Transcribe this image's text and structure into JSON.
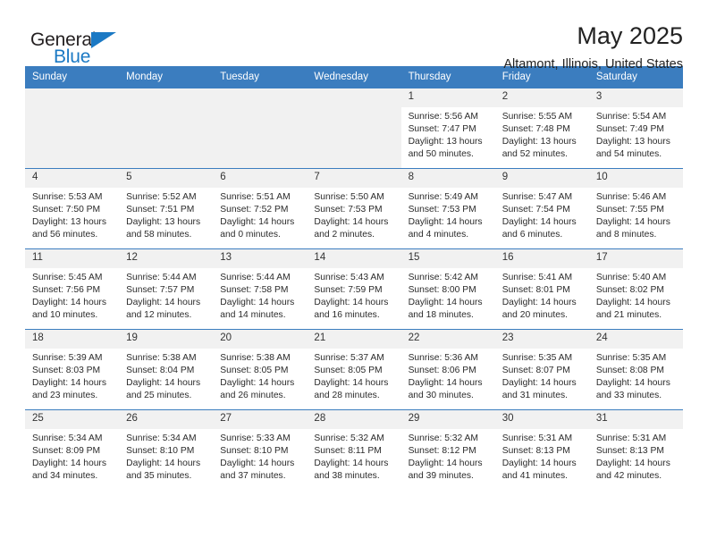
{
  "brand": {
    "name_part1": "General",
    "name_part2": "Blue",
    "accent_color": "#1b79c4"
  },
  "header": {
    "month_title": "May 2025",
    "location": "Altamont, Illinois, United States"
  },
  "calendar": {
    "header_color": "#3b7dbf",
    "daynum_band_color": "#f1f1f1",
    "day_names": [
      "Sunday",
      "Monday",
      "Tuesday",
      "Wednesday",
      "Thursday",
      "Friday",
      "Saturday"
    ],
    "weeks": [
      [
        {
          "day": "",
          "empty": true
        },
        {
          "day": "",
          "empty": true
        },
        {
          "day": "",
          "empty": true
        },
        {
          "day": "",
          "empty": true
        },
        {
          "day": "1",
          "sunrise": "Sunrise: 5:56 AM",
          "sunset": "Sunset: 7:47 PM",
          "daylight": "Daylight: 13 hours and 50 minutes."
        },
        {
          "day": "2",
          "sunrise": "Sunrise: 5:55 AM",
          "sunset": "Sunset: 7:48 PM",
          "daylight": "Daylight: 13 hours and 52 minutes."
        },
        {
          "day": "3",
          "sunrise": "Sunrise: 5:54 AM",
          "sunset": "Sunset: 7:49 PM",
          "daylight": "Daylight: 13 hours and 54 minutes."
        }
      ],
      [
        {
          "day": "4",
          "sunrise": "Sunrise: 5:53 AM",
          "sunset": "Sunset: 7:50 PM",
          "daylight": "Daylight: 13 hours and 56 minutes."
        },
        {
          "day": "5",
          "sunrise": "Sunrise: 5:52 AM",
          "sunset": "Sunset: 7:51 PM",
          "daylight": "Daylight: 13 hours and 58 minutes."
        },
        {
          "day": "6",
          "sunrise": "Sunrise: 5:51 AM",
          "sunset": "Sunset: 7:52 PM",
          "daylight": "Daylight: 14 hours and 0 minutes."
        },
        {
          "day": "7",
          "sunrise": "Sunrise: 5:50 AM",
          "sunset": "Sunset: 7:53 PM",
          "daylight": "Daylight: 14 hours and 2 minutes."
        },
        {
          "day": "8",
          "sunrise": "Sunrise: 5:49 AM",
          "sunset": "Sunset: 7:53 PM",
          "daylight": "Daylight: 14 hours and 4 minutes."
        },
        {
          "day": "9",
          "sunrise": "Sunrise: 5:47 AM",
          "sunset": "Sunset: 7:54 PM",
          "daylight": "Daylight: 14 hours and 6 minutes."
        },
        {
          "day": "10",
          "sunrise": "Sunrise: 5:46 AM",
          "sunset": "Sunset: 7:55 PM",
          "daylight": "Daylight: 14 hours and 8 minutes."
        }
      ],
      [
        {
          "day": "11",
          "sunrise": "Sunrise: 5:45 AM",
          "sunset": "Sunset: 7:56 PM",
          "daylight": "Daylight: 14 hours and 10 minutes."
        },
        {
          "day": "12",
          "sunrise": "Sunrise: 5:44 AM",
          "sunset": "Sunset: 7:57 PM",
          "daylight": "Daylight: 14 hours and 12 minutes."
        },
        {
          "day": "13",
          "sunrise": "Sunrise: 5:44 AM",
          "sunset": "Sunset: 7:58 PM",
          "daylight": "Daylight: 14 hours and 14 minutes."
        },
        {
          "day": "14",
          "sunrise": "Sunrise: 5:43 AM",
          "sunset": "Sunset: 7:59 PM",
          "daylight": "Daylight: 14 hours and 16 minutes."
        },
        {
          "day": "15",
          "sunrise": "Sunrise: 5:42 AM",
          "sunset": "Sunset: 8:00 PM",
          "daylight": "Daylight: 14 hours and 18 minutes."
        },
        {
          "day": "16",
          "sunrise": "Sunrise: 5:41 AM",
          "sunset": "Sunset: 8:01 PM",
          "daylight": "Daylight: 14 hours and 20 minutes."
        },
        {
          "day": "17",
          "sunrise": "Sunrise: 5:40 AM",
          "sunset": "Sunset: 8:02 PM",
          "daylight": "Daylight: 14 hours and 21 minutes."
        }
      ],
      [
        {
          "day": "18",
          "sunrise": "Sunrise: 5:39 AM",
          "sunset": "Sunset: 8:03 PM",
          "daylight": "Daylight: 14 hours and 23 minutes."
        },
        {
          "day": "19",
          "sunrise": "Sunrise: 5:38 AM",
          "sunset": "Sunset: 8:04 PM",
          "daylight": "Daylight: 14 hours and 25 minutes."
        },
        {
          "day": "20",
          "sunrise": "Sunrise: 5:38 AM",
          "sunset": "Sunset: 8:05 PM",
          "daylight": "Daylight: 14 hours and 26 minutes."
        },
        {
          "day": "21",
          "sunrise": "Sunrise: 5:37 AM",
          "sunset": "Sunset: 8:05 PM",
          "daylight": "Daylight: 14 hours and 28 minutes."
        },
        {
          "day": "22",
          "sunrise": "Sunrise: 5:36 AM",
          "sunset": "Sunset: 8:06 PM",
          "daylight": "Daylight: 14 hours and 30 minutes."
        },
        {
          "day": "23",
          "sunrise": "Sunrise: 5:35 AM",
          "sunset": "Sunset: 8:07 PM",
          "daylight": "Daylight: 14 hours and 31 minutes."
        },
        {
          "day": "24",
          "sunrise": "Sunrise: 5:35 AM",
          "sunset": "Sunset: 8:08 PM",
          "daylight": "Daylight: 14 hours and 33 minutes."
        }
      ],
      [
        {
          "day": "25",
          "sunrise": "Sunrise: 5:34 AM",
          "sunset": "Sunset: 8:09 PM",
          "daylight": "Daylight: 14 hours and 34 minutes."
        },
        {
          "day": "26",
          "sunrise": "Sunrise: 5:34 AM",
          "sunset": "Sunset: 8:10 PM",
          "daylight": "Daylight: 14 hours and 35 minutes."
        },
        {
          "day": "27",
          "sunrise": "Sunrise: 5:33 AM",
          "sunset": "Sunset: 8:10 PM",
          "daylight": "Daylight: 14 hours and 37 minutes."
        },
        {
          "day": "28",
          "sunrise": "Sunrise: 5:32 AM",
          "sunset": "Sunset: 8:11 PM",
          "daylight": "Daylight: 14 hours and 38 minutes."
        },
        {
          "day": "29",
          "sunrise": "Sunrise: 5:32 AM",
          "sunset": "Sunset: 8:12 PM",
          "daylight": "Daylight: 14 hours and 39 minutes."
        },
        {
          "day": "30",
          "sunrise": "Sunrise: 5:31 AM",
          "sunset": "Sunset: 8:13 PM",
          "daylight": "Daylight: 14 hours and 41 minutes."
        },
        {
          "day": "31",
          "sunrise": "Sunrise: 5:31 AM",
          "sunset": "Sunset: 8:13 PM",
          "daylight": "Daylight: 14 hours and 42 minutes."
        }
      ]
    ]
  }
}
